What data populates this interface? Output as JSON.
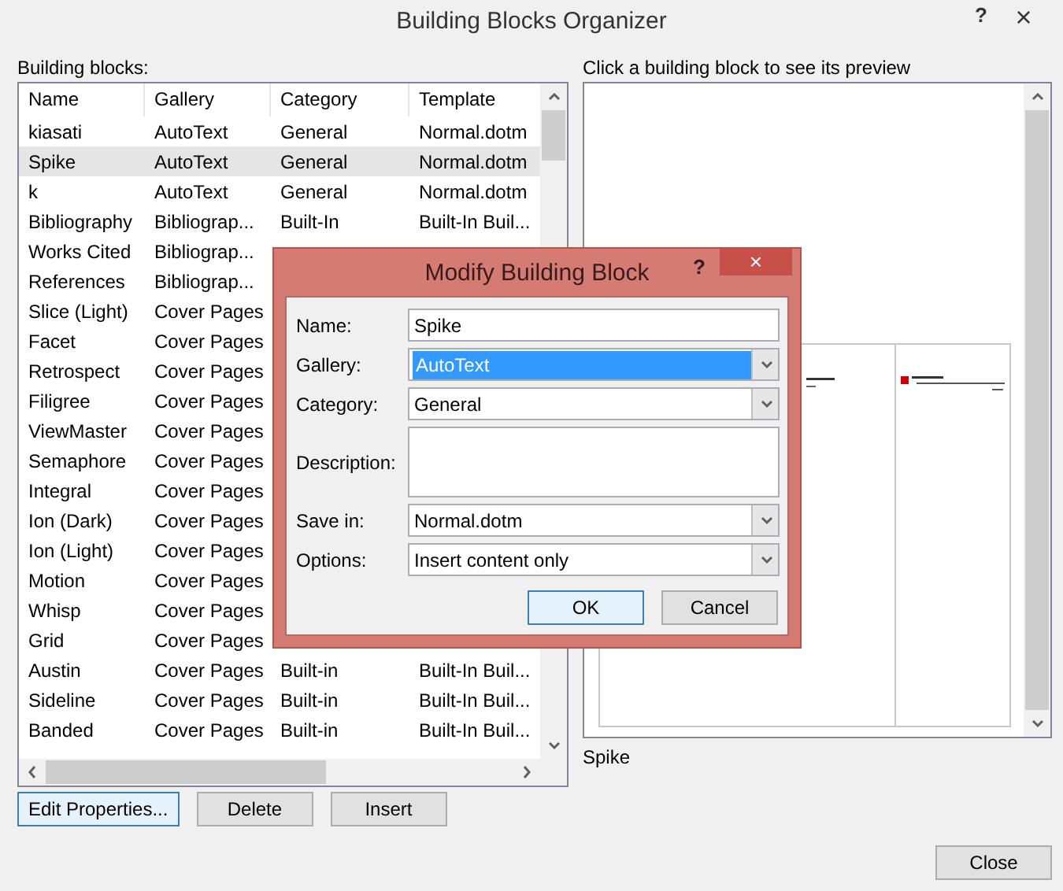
{
  "window": {
    "title": "Building Blocks Organizer",
    "help": "?",
    "close": "×"
  },
  "list_label": "Building blocks:",
  "table": {
    "columns": [
      "Name",
      "Gallery",
      "Category",
      "Template"
    ],
    "rows": [
      {
        "name": "kiasati",
        "gallery": "AutoText",
        "category": "General",
        "template": "Normal.dotm",
        "selected": false
      },
      {
        "name": "Spike",
        "gallery": "AutoText",
        "category": "General",
        "template": "Normal.dotm",
        "selected": true
      },
      {
        "name": "k",
        "gallery": "AutoText",
        "category": "General",
        "template": "Normal.dotm",
        "selected": false
      },
      {
        "name": "Bibliography",
        "gallery": "Bibliograp...",
        "category": "Built-In",
        "template": "Built-In Buil...",
        "selected": false
      },
      {
        "name": "Works Cited",
        "gallery": "Bibliograp...",
        "selected": false
      },
      {
        "name": "References",
        "gallery": "Bibliograp...",
        "selected": false
      },
      {
        "name": "Slice (Light)",
        "gallery": "Cover Pages",
        "selected": false
      },
      {
        "name": "Facet",
        "gallery": "Cover Pages",
        "selected": false
      },
      {
        "name": "Retrospect",
        "gallery": "Cover Pages",
        "selected": false
      },
      {
        "name": "Filigree",
        "gallery": "Cover Pages",
        "selected": false
      },
      {
        "name": "ViewMaster",
        "gallery": "Cover Pages",
        "selected": false
      },
      {
        "name": "Semaphore",
        "gallery": "Cover Pages",
        "selected": false
      },
      {
        "name": "Integral",
        "gallery": "Cover Pages",
        "selected": false
      },
      {
        "name": "Ion (Dark)",
        "gallery": "Cover Pages",
        "selected": false
      },
      {
        "name": "Ion (Light)",
        "gallery": "Cover Pages",
        "selected": false
      },
      {
        "name": "Motion",
        "gallery": "Cover Pages",
        "selected": false
      },
      {
        "name": "Whisp",
        "gallery": "Cover Pages",
        "selected": false
      },
      {
        "name": "Grid",
        "gallery": "Cover Pages",
        "selected": false
      },
      {
        "name": "Austin",
        "gallery": "Cover Pages",
        "category": "Built-in",
        "template": "Built-In Buil...",
        "selected": false
      },
      {
        "name": "Sideline",
        "gallery": "Cover Pages",
        "category": "Built-in",
        "template": "Built-In Buil...",
        "selected": false
      },
      {
        "name": "Banded",
        "gallery": "Cover Pages",
        "category": "Built-in",
        "template": "Built-In Buil...",
        "selected": false
      }
    ]
  },
  "buttons": [
    {
      "label": "Edit Properties...",
      "focused": true
    },
    {
      "label": "Delete",
      "focused": false
    },
    {
      "label": "Insert",
      "focused": false
    }
  ],
  "preview": {
    "label": "Click a building block to see its preview",
    "caption": "Spike"
  },
  "close_button": "Close",
  "modify_dialog": {
    "title": "Modify Building Block",
    "help": "?",
    "close": "×",
    "fields": [
      {
        "kind": "text",
        "label": "Name:",
        "value": "Spike",
        "highlighted": false
      },
      {
        "kind": "dropdown",
        "label": "Gallery:",
        "value": "AutoText",
        "highlighted": true
      },
      {
        "kind": "dropdown",
        "label": "Category:",
        "value": "General",
        "highlighted": false
      },
      {
        "kind": "textarea",
        "label": "Description:",
        "highlighted": false
      },
      {
        "kind": "dropdown",
        "label": "Save in:",
        "value": "Normal.dotm",
        "highlighted": false
      },
      {
        "kind": "dropdown",
        "label": "Options:",
        "value": "Insert content only",
        "highlighted": false
      }
    ],
    "buttons": [
      {
        "label": "OK",
        "focused": true
      },
      {
        "label": "Cancel",
        "focused": false
      }
    ]
  }
}
